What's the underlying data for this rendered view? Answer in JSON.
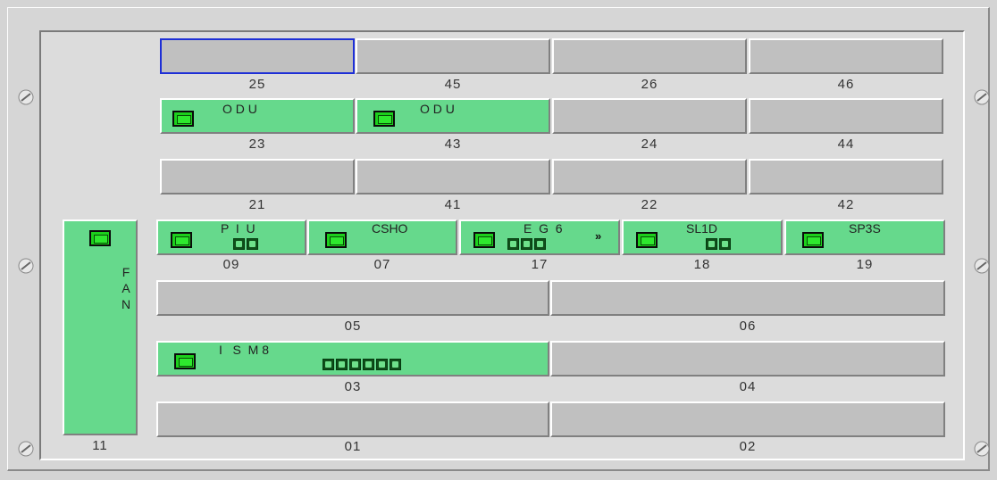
{
  "slots_top": [
    {
      "id": "25",
      "label": "25",
      "state": "selected"
    },
    {
      "id": "45",
      "label": "45",
      "state": "empty"
    },
    {
      "id": "26",
      "label": "26",
      "state": "empty"
    },
    {
      "id": "46",
      "label": "46",
      "state": "empty"
    },
    {
      "id": "23",
      "label": "23",
      "state": "board",
      "board": "O D U"
    },
    {
      "id": "43",
      "label": "43",
      "state": "board",
      "board": "O D U"
    },
    {
      "id": "24",
      "label": "24",
      "state": "empty"
    },
    {
      "id": "44",
      "label": "44",
      "state": "empty"
    },
    {
      "id": "21",
      "label": "21",
      "state": "empty"
    },
    {
      "id": "41",
      "label": "41",
      "state": "empty"
    },
    {
      "id": "22",
      "label": "22",
      "state": "empty"
    },
    {
      "id": "42",
      "label": "42",
      "state": "empty"
    }
  ],
  "slots_mid": [
    {
      "id": "09",
      "label": "09",
      "board": "P  I  U"
    },
    {
      "id": "07",
      "label": "07",
      "board": "CSHO"
    },
    {
      "id": "17",
      "label": "17",
      "board": "E  G  6"
    },
    {
      "id": "18",
      "label": "18",
      "board": "SL1D"
    },
    {
      "id": "19",
      "label": "19",
      "board": "SP3S"
    }
  ],
  "slots_wide": [
    {
      "id": "05",
      "label": "05"
    },
    {
      "id": "06",
      "label": "06"
    },
    {
      "id": "03",
      "label": "03",
      "board": "I   S  M 8"
    },
    {
      "id": "04",
      "label": "04"
    },
    {
      "id": "01",
      "label": "01"
    },
    {
      "id": "02",
      "label": "02"
    }
  ],
  "fan": {
    "label": "11",
    "letters": [
      "F",
      "A",
      "N"
    ]
  },
  "colors": {
    "board": "#66d98c",
    "empty": "#c0c0c0",
    "selected_border": "#1e2fd6"
  },
  "icons": {
    "led": "status-led-icon",
    "port": "port-icon",
    "expand": "double-chevron-right-icon",
    "screw": "screw-icon"
  },
  "expand_glyph": "»"
}
